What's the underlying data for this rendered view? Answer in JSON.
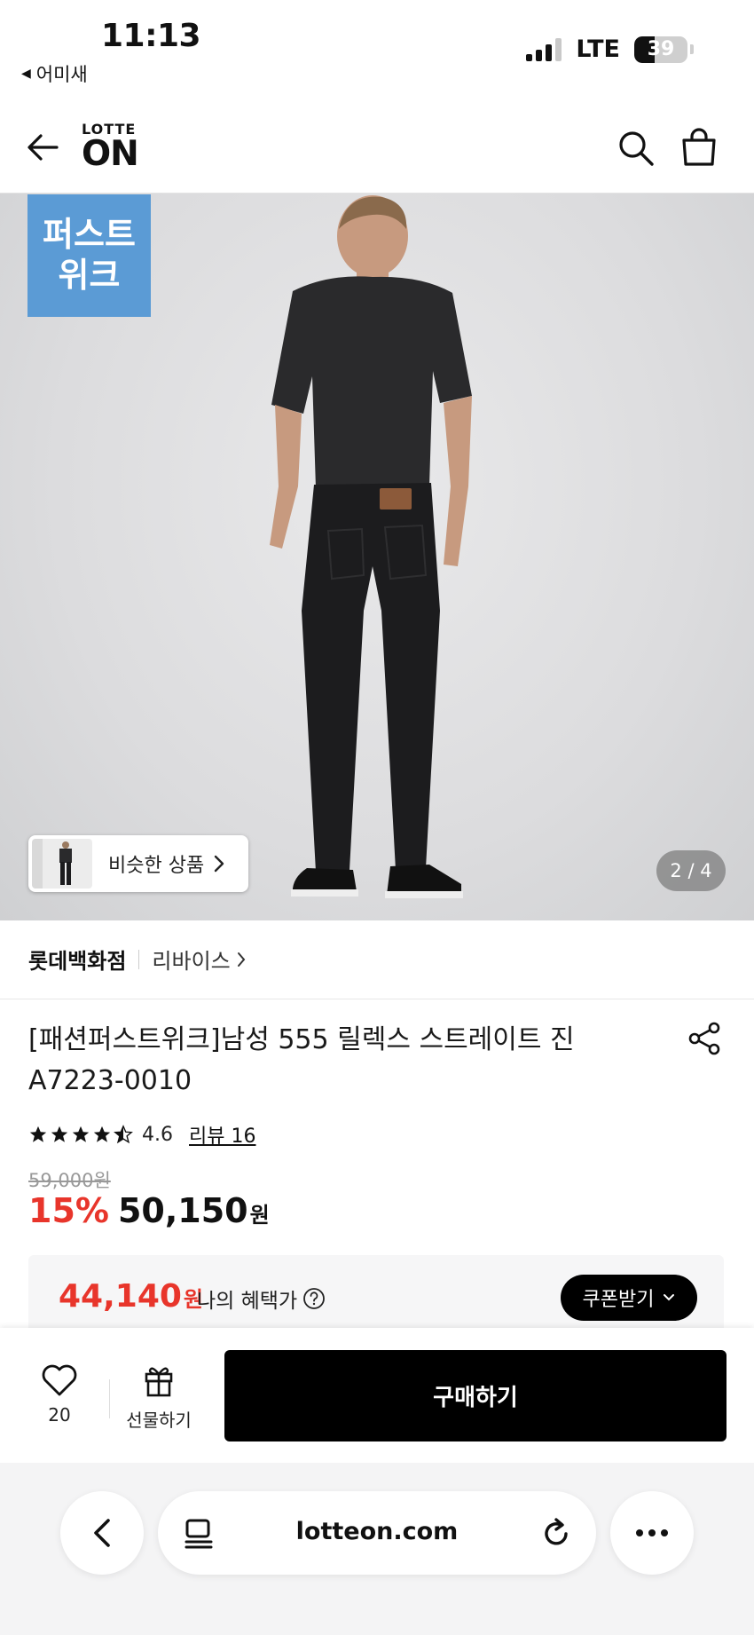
{
  "status_bar": {
    "time": "11:13",
    "back_app": "어미새",
    "network": "LTE",
    "battery": "39",
    "battery_level": 0.39
  },
  "header": {
    "logo_top": "LOTTE",
    "logo_bottom": "ON"
  },
  "hero": {
    "badge_line1": "퍼스트",
    "badge_line2": "위크",
    "similar_label": "비슷한 상품",
    "page_indicator": "2 / 4"
  },
  "brand": {
    "store": "롯데백화점",
    "name": "리바이스"
  },
  "product": {
    "title": "[패션퍼스트위크]남성 555 릴렉스 스트레이트 진 A7223-0010",
    "rating": "4.6",
    "rating_value": 4.6,
    "review_link": "리뷰 16",
    "original_price": "59,000원",
    "discount": "15%",
    "sale_price": "50,150",
    "currency": "원"
  },
  "benefit": {
    "price": "44,140",
    "currency": "원",
    "label": "나의 혜택가",
    "coupon_button": "쿠폰받기"
  },
  "action_bar": {
    "like_count": "20",
    "gift_label": "선물하기",
    "buy_label": "구매하기"
  },
  "browser": {
    "url": "lotteon.com"
  },
  "colors": {
    "accent_red": "#e8352b",
    "badge_blue": "#5b9bd5",
    "black": "#000000"
  },
  "icons": [
    "back-arrow-icon",
    "search-icon",
    "cart-icon",
    "share-icon",
    "star-icon",
    "help-icon",
    "chevron-down-icon",
    "heart-icon",
    "gift-icon",
    "tabs-icon",
    "reload-icon",
    "more-icon",
    "chevron-left-icon"
  ]
}
